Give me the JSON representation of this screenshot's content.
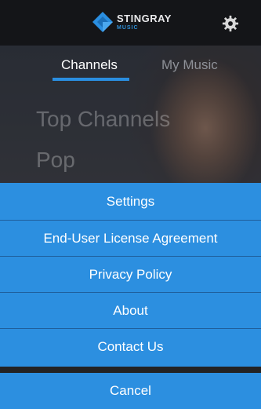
{
  "header": {
    "brand_name": "STINGRAY",
    "brand_sub": "MUSIC",
    "logo_icon": "stingray-logo-icon",
    "settings_icon": "gear-icon"
  },
  "tabs": [
    {
      "label": "Channels",
      "active": true
    },
    {
      "label": "My Music",
      "active": false
    }
  ],
  "categories": [
    "Top Channels",
    "Pop"
  ],
  "action_sheet": {
    "items": [
      {
        "label": "Settings"
      },
      {
        "label": "End-User License Agreement"
      },
      {
        "label": "Privacy Policy"
      },
      {
        "label": "About"
      },
      {
        "label": "Contact Us"
      }
    ],
    "cancel_label": "Cancel"
  },
  "colors": {
    "accent": "#2c8fe0",
    "topbar": "#141518",
    "brand_sub": "#2f8fd6"
  }
}
